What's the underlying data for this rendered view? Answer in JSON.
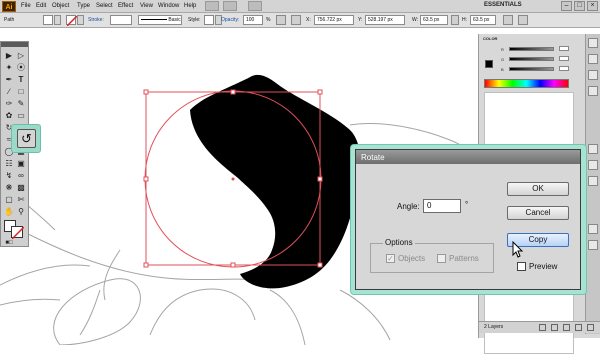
{
  "app": {
    "logo": "Ai",
    "workspace": "ESSENTIALS"
  },
  "menus": [
    "File",
    "Edit",
    "Object",
    "Type",
    "Select",
    "Effect",
    "View",
    "Window",
    "Help"
  ],
  "control_bar": {
    "selection": "Path",
    "stroke_label": "Stroke:",
    "brush_label": "Basic",
    "style_label": "Style:",
    "opacity_label": "Opacity:",
    "opacity_value": "100",
    "opacity_unit": "%",
    "x_label": "X:",
    "x_value": "756.722 px",
    "y_label": "Y:",
    "y_value": "528.197 px",
    "w_label": "W:",
    "w_value": "63.5 px",
    "h_label": "H:",
    "h_value": "63.5 px"
  },
  "color_panel": {
    "tab": "COLOR",
    "channels": [
      "R",
      "G",
      "B"
    ]
  },
  "layers_panel": {
    "count": "2 Layers"
  },
  "dialog": {
    "title": "Rotate",
    "angle_label": "Angle:",
    "angle_value": "0",
    "angle_unit": "°",
    "ok": "OK",
    "cancel": "Cancel",
    "copy": "Copy",
    "preview": "Preview",
    "options_label": "Options",
    "objects": "Objects",
    "patterns": "Patterns",
    "objects_checked": true,
    "patterns_checked": false,
    "preview_checked": false
  },
  "colors": {
    "callout": "#a6e3d3",
    "selection_bounds": "#e0505a",
    "shape_fill": "#000000"
  },
  "icons": [
    "rotate-tool-icon",
    "selection-tool-icon",
    "pen-tool-icon",
    "type-tool-icon",
    "pointer-cursor-icon"
  ]
}
